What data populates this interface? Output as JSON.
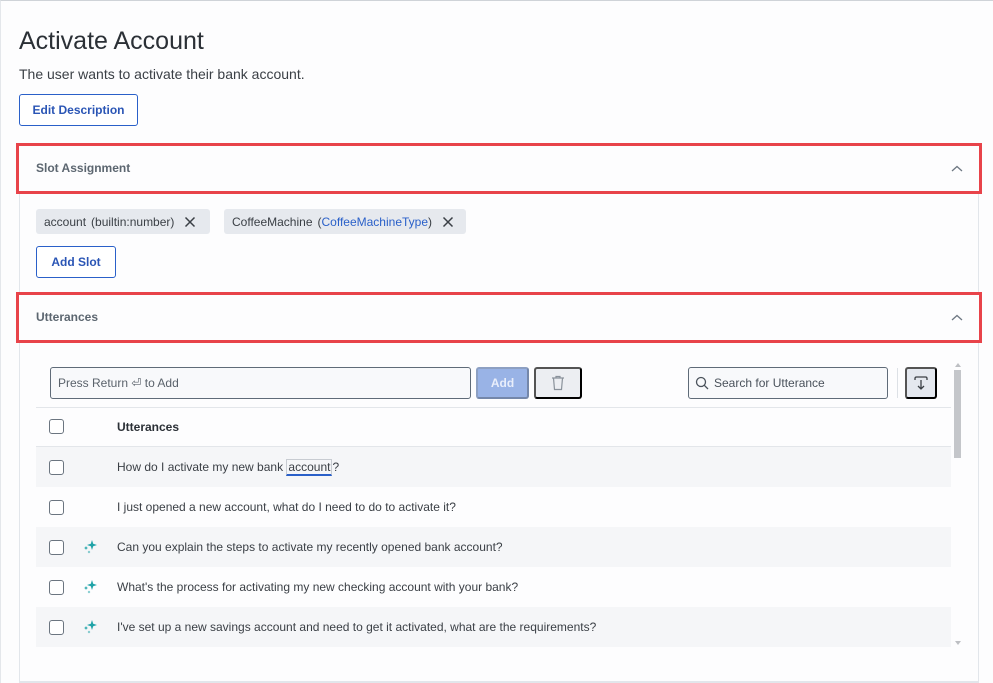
{
  "page": {
    "title": "Activate Account",
    "description": "The user wants to activate their bank account.",
    "edit_description_label": "Edit Description"
  },
  "slot_assignment": {
    "header": "Slot Assignment",
    "expanded": true,
    "slots": [
      {
        "name": "account",
        "type": "(builtin:number)",
        "type_prefix": "",
        "type_link": "",
        "type_suffix": ""
      },
      {
        "name": "CoffeeMachine",
        "type_prefix": "(",
        "type_link": "CoffeeMachineType",
        "type_suffix": ")"
      }
    ],
    "add_slot_label": "Add Slot"
  },
  "utterances": {
    "header": "Utterances",
    "expanded": true,
    "input_placeholder": "Press Return ⏎ to Add",
    "add_label": "Add",
    "search_placeholder": "Search for Utterance",
    "column_header": "Utterances",
    "rows": [
      {
        "pre": "How do I activate my new bank ",
        "slot": "account",
        "post": "?",
        "generated": false,
        "checked": false
      },
      {
        "text": "I just opened a new account, what do I need to do to activate it?",
        "generated": false,
        "checked": false
      },
      {
        "text": "Can you explain the steps to activate my recently opened bank account?",
        "generated": true,
        "checked": false
      },
      {
        "text": "What's the process for activating my new checking account with your bank?",
        "generated": true,
        "checked": false
      },
      {
        "text": "I've set up a new savings account and need to get it activated, what are the requirements?",
        "generated": true,
        "checked": false
      }
    ]
  },
  "colors": {
    "accent": "#2a60c9",
    "highlight_border": "#e8434a",
    "sparkle": "#1fa3a8"
  }
}
